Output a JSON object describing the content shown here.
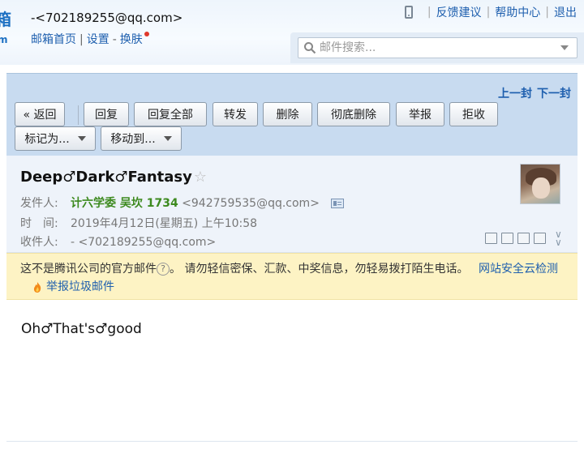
{
  "header": {
    "logo": {
      "line1": "箱",
      "line2": "m"
    },
    "user_email": "-<702189255@qq.com>",
    "links": {
      "home": "邮箱首页",
      "settings": "设置",
      "skin": "换肤"
    },
    "sep1": "|",
    "sep2": "-",
    "right": {
      "feedback": "反馈建议",
      "help": "帮助中心",
      "logout": "退出"
    },
    "right_sep": "|",
    "search": {
      "placeholder": "邮件搜索..."
    }
  },
  "toolbar": {
    "prev": "上一封",
    "next": "下一封",
    "buttons": {
      "back": "« 返回",
      "reply": "回复",
      "reply_all": "回复全部",
      "forward": "转发",
      "delete": "删除",
      "perm_delete": "彻底删除",
      "report": "举报",
      "reject": "拒收",
      "mark_as": "标记为...",
      "move_to": "移动到..."
    }
  },
  "mail": {
    "subject": "Deep♂Dark♂Fantasy",
    "star": "☆",
    "sender_label": "发件人:",
    "sender_name": "计六学委 吴坎 1734",
    "sender_email": "<942759535@qq.com>",
    "time_label": "时　间:",
    "time": "2019年4月12日(星期五) 上午10:58",
    "to_label": "收件人:",
    "to": "- <702189255@qq.com>",
    "body": "Oh♂That's♂good"
  },
  "notice": {
    "text1": "这不是腾讯公司的官方邮件",
    "help": "?",
    "text2": "。 请勿轻信密保、汇款、中奖信息，勿轻易拨打陌生电话。",
    "report": "举报垃圾邮件",
    "security": "网站安全云检测"
  },
  "colors": {
    "link": "#1e5fae",
    "sender_name": "#3d8a1f",
    "toolbar_bg": "#c8dbf0",
    "notice_bg": "#fdf3c4",
    "unread_dot": "#e0392b"
  },
  "icons": [
    "phone-icon",
    "search-icon",
    "star-icon",
    "contact-card-icon",
    "fire-icon",
    "help-icon",
    "expand-icon"
  ]
}
